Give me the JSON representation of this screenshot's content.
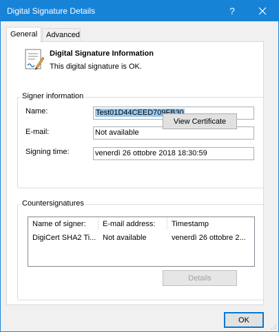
{
  "window": {
    "title": "Digital Signature Details",
    "help_glyph": "?",
    "accent_color": "#1783d7"
  },
  "tabs": [
    {
      "label": "General",
      "active": true
    },
    {
      "label": "Advanced",
      "active": false
    }
  ],
  "info": {
    "icon": "certificate-document-icon",
    "title": "Digital Signature Information",
    "status": "This digital signature is OK."
  },
  "signer": {
    "group_label": "Signer information",
    "name_label": "Name:",
    "name_value": "Test01D44CEED709FB30",
    "email_label": "E-mail:",
    "email_value": "Not available",
    "time_label": "Signing time:",
    "time_value": "venerdì 26 ottobre 2018 18:30:59",
    "view_certificate_label": "View Certificate"
  },
  "countersignatures": {
    "group_label": "Countersignatures",
    "columns": [
      "Name of signer:",
      "E-mail address:",
      "Timestamp"
    ],
    "rows": [
      [
        "DigiCert SHA2 Ti...",
        "Not available",
        "venerdì 26 ottobre 2..."
      ]
    ],
    "details_label": "Details"
  },
  "footer": {
    "ok_label": "OK"
  }
}
